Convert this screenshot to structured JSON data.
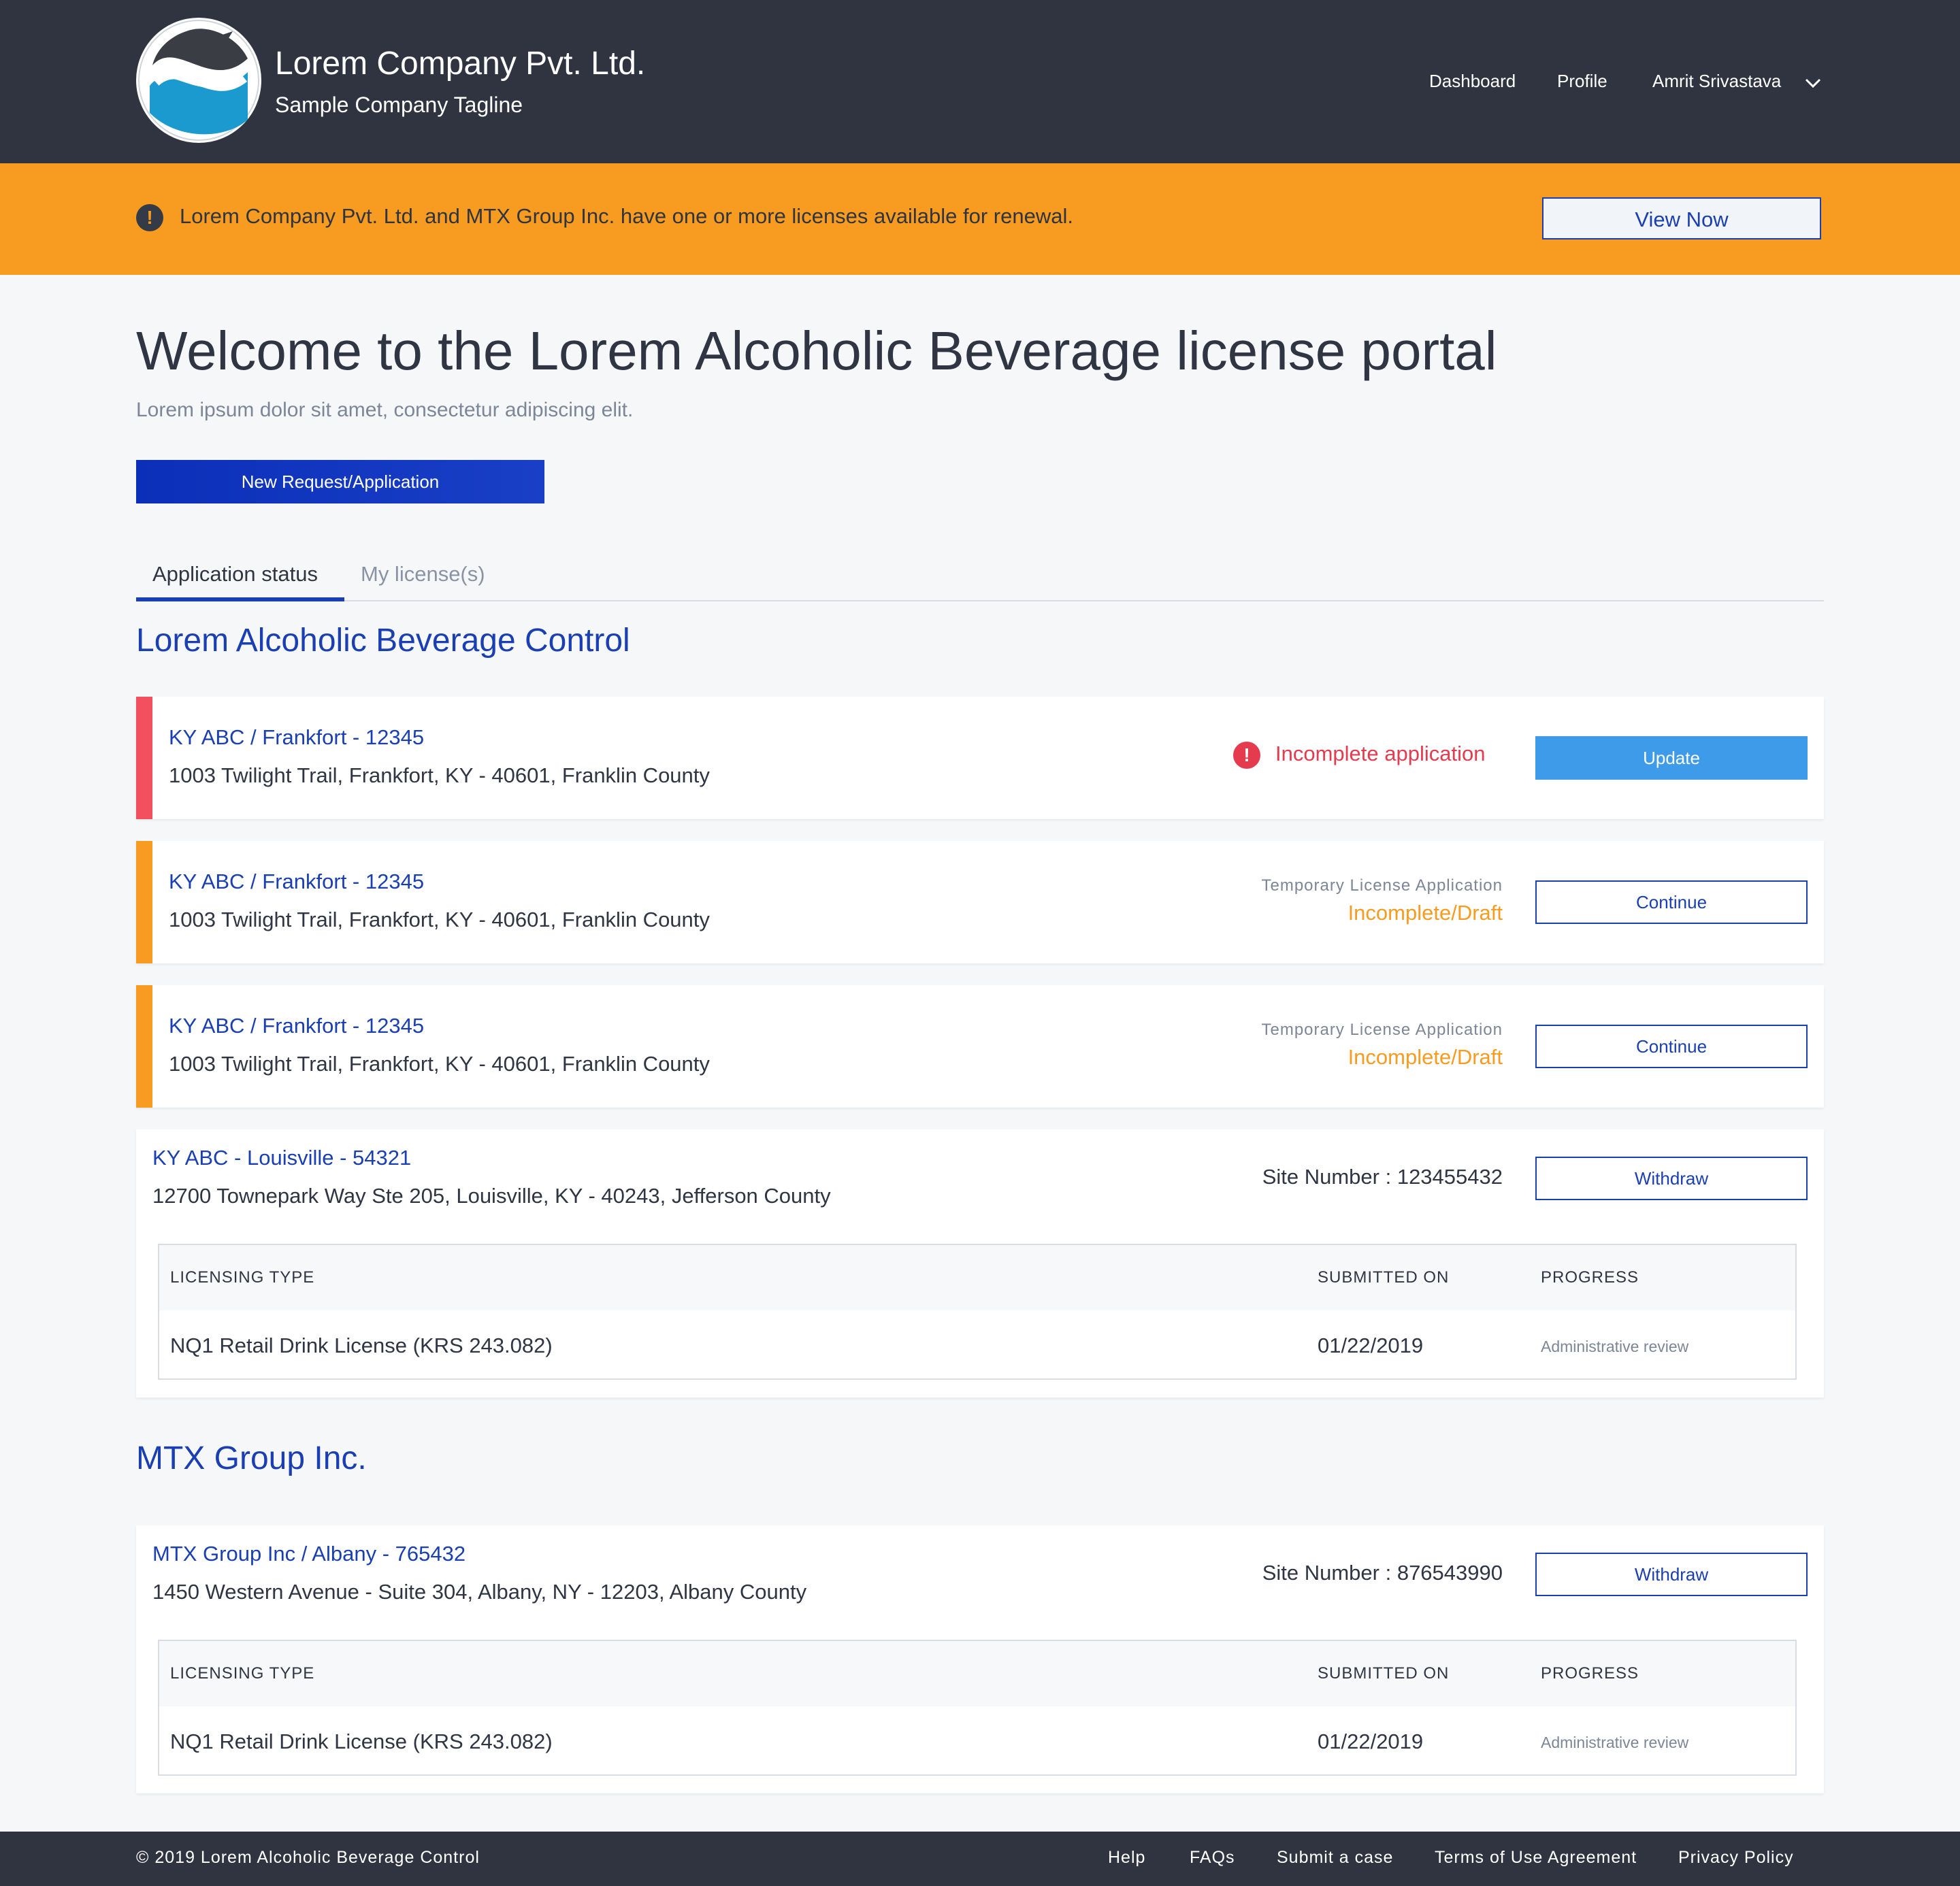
{
  "header": {
    "company_name": "Lorem Company Pvt. Ltd.",
    "tagline": "Sample Company Tagline",
    "nav": {
      "dashboard": "Dashboard",
      "profile": "Profile",
      "user": "Amrit Srivastava"
    },
    "icons": {
      "logo": "company-logo",
      "user_menu": "chevron-down-icon"
    }
  },
  "banner": {
    "icon": "exclamation-circle-icon",
    "message": "Lorem Company Pvt. Ltd. and MTX Group Inc. have one or more licenses available for renewal.",
    "button": "View Now"
  },
  "main": {
    "title": "Welcome to the Lorem Alcoholic Beverage license portal",
    "subtitle": "Lorem ipsum dolor sit amet, consectetur adipiscing elit.",
    "new_request_button": "New Request/Application",
    "tabs": [
      {
        "label": "Application status",
        "active": true
      },
      {
        "label": "My license(s)",
        "active": false
      }
    ],
    "sections": [
      {
        "title": "Lorem Alcoholic Beverage Control",
        "cards": [
          {
            "id": "KY ABC / Frankfort - 12345",
            "address": "1003 Twilight Trail, Frankfort, KY - 40601, Franklin County",
            "status": "Incomplete application",
            "button": "Update"
          },
          {
            "id": "KY ABC / Frankfort - 12345",
            "address": "1003 Twilight Trail, Frankfort, KY - 40601, Franklin County",
            "status_label": "Temporary License Application",
            "status": "Incomplete/Draft",
            "button": "Continue"
          },
          {
            "id": "KY ABC / Frankfort - 12345",
            "address": "1003 Twilight Trail, Frankfort, KY - 40601, Franklin County",
            "status_label": "Temporary License Application",
            "status": "Incomplete/Draft",
            "button": "Continue"
          },
          {
            "id": "KY ABC - Louisville - 54321",
            "address": "12700 Townepark Way Ste 205, Louisville, KY - 40243, Jefferson County",
            "site_number": "Site Number : 123455432",
            "button": "Withdraw",
            "table": {
              "headers": [
                "LICENSING TYPE",
                "SUBMITTED ON",
                "PROGRESS"
              ],
              "row": [
                "NQ1 Retail Drink License (KRS 243.082)",
                "01/22/2019",
                "Administrative review"
              ]
            }
          }
        ]
      },
      {
        "title": "MTX Group Inc.",
        "cards": [
          {
            "id": "MTX Group Inc / Albany - 765432",
            "address": "1450 Western Avenue - Suite 304, Albany, NY - 12203, Albany County",
            "site_number": "Site Number : 876543990",
            "button": "Withdraw",
            "table": {
              "headers": [
                "LICENSING TYPE",
                "SUBMITTED ON",
                "PROGRESS"
              ],
              "row": [
                "NQ1 Retail Drink License (KRS 243.082)",
                "01/22/2019",
                "Administrative review"
              ]
            }
          }
        ]
      }
    ]
  },
  "footer": {
    "copyright": "© 2019 Lorem Alcoholic Beverage Control",
    "links": [
      "Help",
      "FAQs",
      "Submit a case",
      "Terms of Use Agreement",
      "Privacy Policy"
    ]
  },
  "colors": {
    "header_bg": "#2f3440",
    "banner_bg": "#f79b21",
    "accent_blue": "#1a3fb2",
    "error_red": "#e53b4e",
    "warning_orange": "#f79b21",
    "update_button": "#3d9be9"
  }
}
